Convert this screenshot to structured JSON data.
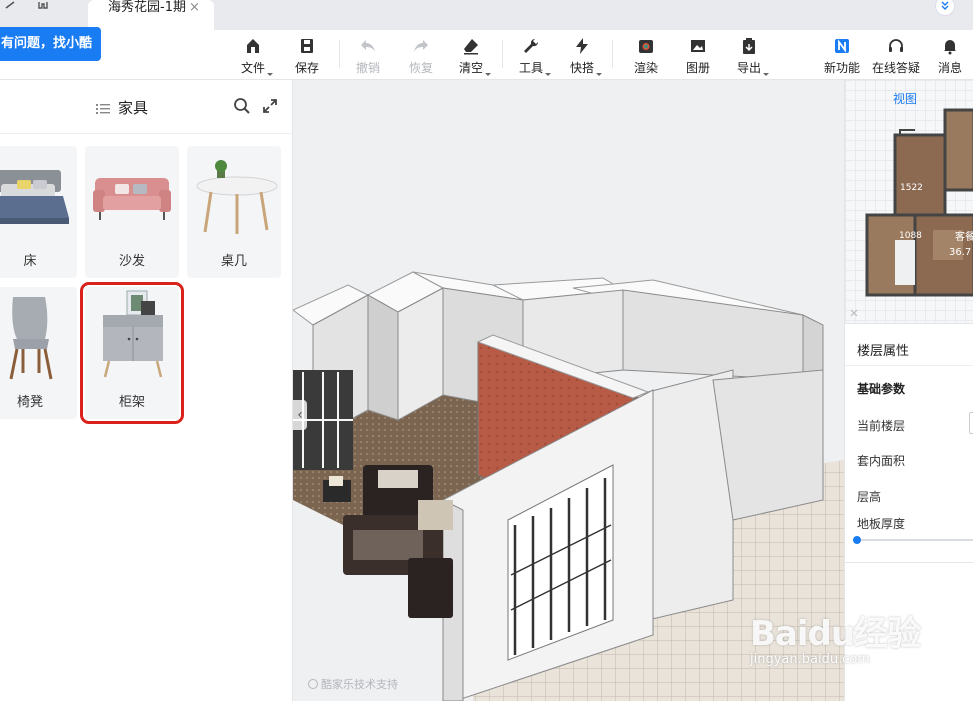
{
  "tab": {
    "title": "海秀花园-1期",
    "close": "×"
  },
  "help": {
    "text": "有问题，找小酷"
  },
  "toolbar": {
    "file": "文件",
    "save": "保存",
    "undo": "撤销",
    "redo": "恢复",
    "clear": "清空",
    "tools": "工具",
    "quick": "快搭",
    "render": "渲染",
    "album": "图册",
    "export": "导出",
    "new_feature": "新功能",
    "online_help": "在线答疑",
    "messages": "消息"
  },
  "panel": {
    "title": "家具",
    "items": [
      {
        "label": "床"
      },
      {
        "label": "沙发"
      },
      {
        "label": "桌几"
      },
      {
        "label": "椅凳"
      },
      {
        "label": "柜架"
      }
    ]
  },
  "viewport": {
    "credit": "酷家乐技术支持"
  },
  "watermark": {
    "brand": "Baidu经验",
    "url": "jingyan.baidu.com"
  },
  "right_panel": {
    "view_tab": "视图",
    "minimap": {
      "area_label": "客餐",
      "area_value": "36.7",
      "dim_1": "1522",
      "dim_2": "1088"
    },
    "properties": {
      "title": "楼层属性",
      "section": "基础参数",
      "current_floor": "当前楼层",
      "inner_area": "套内面积",
      "floor_height": "层高",
      "floor_thickness": "地板厚度"
    }
  },
  "colors": {
    "accent": "#1a7cf2",
    "highlight": "#d9221c",
    "brick": "#b75a46",
    "floor": "#7b6550"
  }
}
